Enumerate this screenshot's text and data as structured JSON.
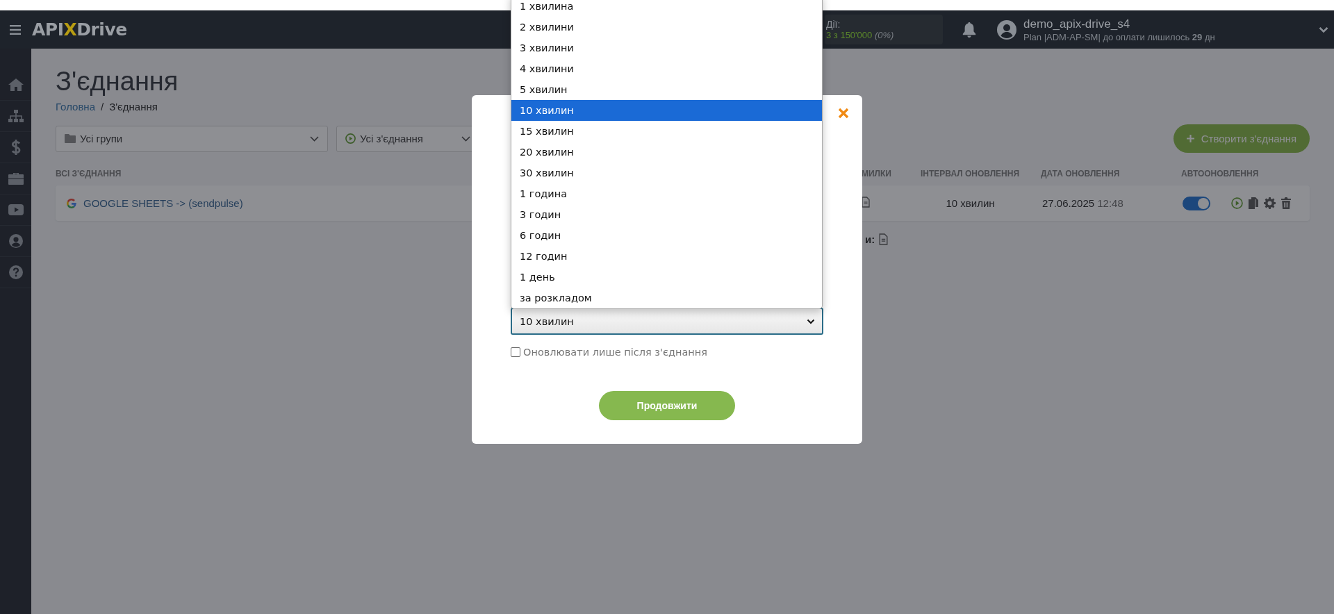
{
  "header": {
    "logo": {
      "prefix": "API",
      "mark": "X",
      "suffix": "Drive"
    },
    "actions": {
      "label": "Дії:",
      "used": "3 з 150'000",
      "percent": "(0%)"
    },
    "user": {
      "name": "demo_apix-drive_s4",
      "plan": "Plan |ADM-AP-SM| до оплати лишилось **29** дн"
    }
  },
  "page": {
    "title": "З'єднання",
    "breadcrumbs": [
      {
        "label": "Головна",
        "link": true
      },
      {
        "separator": "/",
        "label": "З'єднання",
        "link": false
      }
    ],
    "filters": [
      {
        "kind": "group",
        "value": "Усі групи"
      },
      {
        "kind": "status",
        "value": "Усі з'єднання"
      }
    ],
    "create_button": "Створити з'єднання",
    "section_label": "ВСІ З'ЄДНАННЯ"
  },
  "table": {
    "columns": [
      "МИЛКИ",
      "ІНТЕРВАЛ ОНОВЛЕННЯ",
      "ДАТА ОНОВЛЕННЯ",
      "АВТООНОВЛЕННЯ"
    ],
    "rows": [
      {
        "name": "GOOGLE SHEETS -> (sendpulse)",
        "interval": "10 хвилин",
        "date": "27.06.2025",
        "time": "12:48",
        "autoupdate": true
      }
    ]
  },
  "footer_note": "и:",
  "modal": {
    "select": {
      "value": "10 хвилин",
      "options": [
        {
          "label": "1 хвилина",
          "selected": false
        },
        {
          "label": "2 хвилини",
          "selected": false
        },
        {
          "label": "3 хвилини",
          "selected": false
        },
        {
          "label": "4 хвилини",
          "selected": false
        },
        {
          "label": "5 хвилин",
          "selected": false
        },
        {
          "label": "10 хвилин",
          "selected": true
        },
        {
          "label": "15 хвилин",
          "selected": false
        },
        {
          "label": "20 хвилин",
          "selected": false
        },
        {
          "label": "30 хвилин",
          "selected": false
        },
        {
          "label": "1 година",
          "selected": false
        },
        {
          "label": "3 годин",
          "selected": false
        },
        {
          "label": "6 годин",
          "selected": false
        },
        {
          "label": "12 годин",
          "selected": false
        },
        {
          "label": "1 день",
          "selected": false
        },
        {
          "label": "за розкладом",
          "selected": false
        }
      ]
    },
    "checkbox": {
      "label": "Оновлювати лише після з'єднання",
      "checked": false
    },
    "button": "Продовжити"
  }
}
